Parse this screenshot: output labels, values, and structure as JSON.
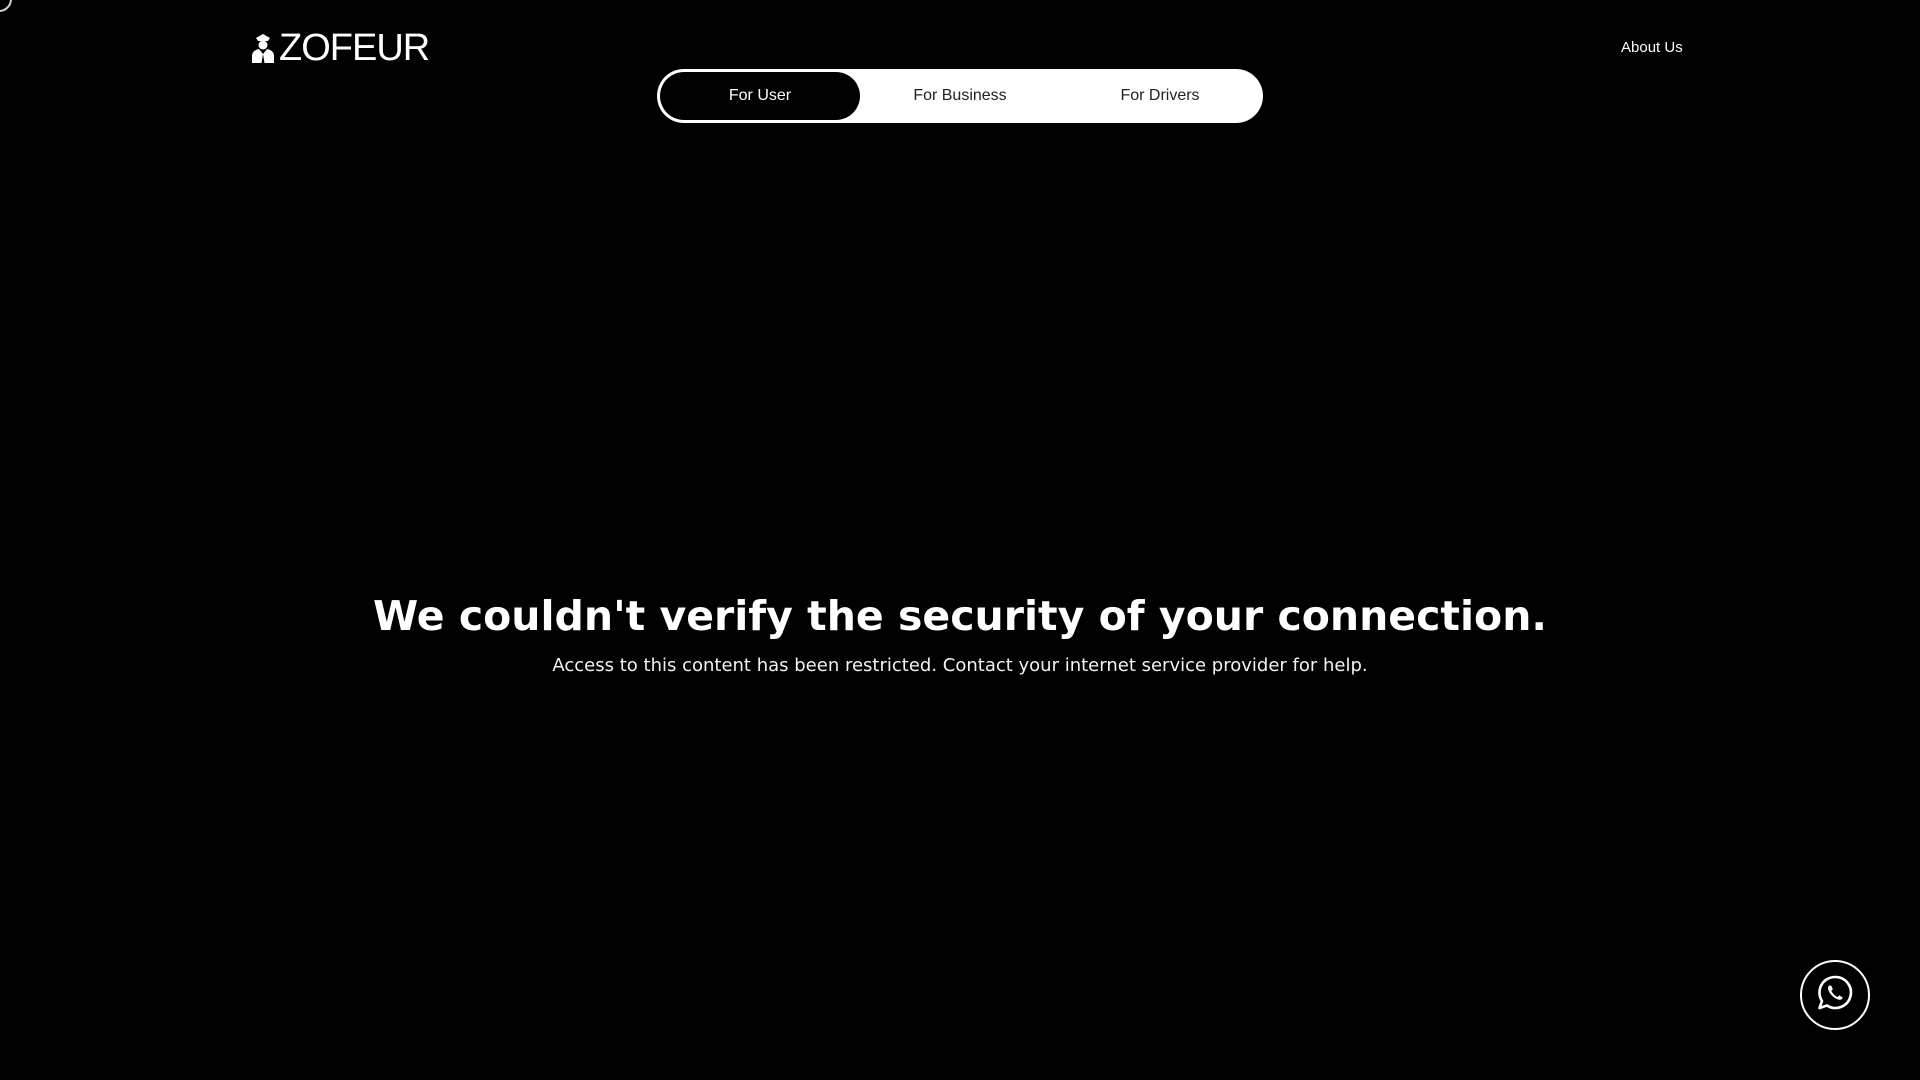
{
  "brand": {
    "logo_text": "ZOFEUR",
    "logo_icon": "chauffeur-icon"
  },
  "nav": {
    "about_label": "About Us"
  },
  "audience_tabs": {
    "items": [
      {
        "label": "For User",
        "active": true
      },
      {
        "label": "For Business",
        "active": false
      },
      {
        "label": "For Drivers",
        "active": false
      }
    ]
  },
  "message": {
    "headline": "We couldn't verify the security of your connection.",
    "body": "Access to this content has been restricted. Contact your internet service provider for help."
  },
  "chat_widget": {
    "icon": "whatsapp-icon"
  },
  "colors": {
    "background": "#000000",
    "text": "#ffffff",
    "tab_container": "#ffffff",
    "tab_active": "#000000"
  }
}
